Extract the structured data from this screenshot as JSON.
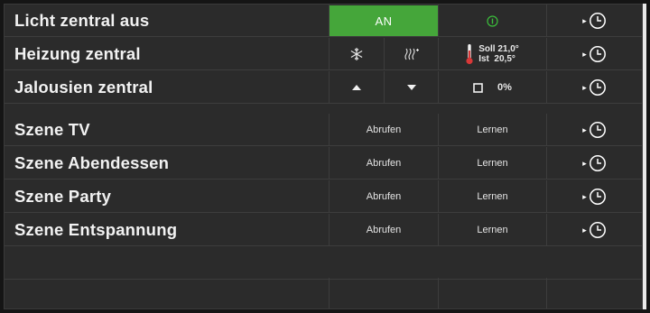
{
  "rows": [
    {
      "label": "Licht zentral aus",
      "on_label": "AN"
    },
    {
      "label": "Heizung zentral",
      "soll": "Soll 21,0°",
      "ist": "Ist  20,5°"
    },
    {
      "label": "Jalousien zentral",
      "percent": "0%"
    },
    {
      "label": "Szene TV",
      "recall": "Abrufen",
      "learn": "Lernen"
    },
    {
      "label": "Szene Abendessen",
      "recall": "Abrufen",
      "learn": "Lernen"
    },
    {
      "label": "Szene Party",
      "recall": "Abrufen",
      "learn": "Lernen"
    },
    {
      "label": "Szene Entspannung",
      "recall": "Abrufen",
      "learn": "Lernen"
    }
  ],
  "icons": {
    "power": "power-icon",
    "timer": "clock-icon",
    "play": "play-arrow-icon",
    "cool": "snowflake-icon",
    "heat": "heat-waves-icon",
    "thermometer": "thermometer-icon",
    "up": "triangle-up-icon",
    "down": "triangle-down-icon",
    "stop": "square-icon"
  },
  "colors": {
    "background": "#2b2b2b",
    "on_green": "#45a63a",
    "power_green": "#3bbf3b",
    "thermo_red": "#d93838"
  }
}
